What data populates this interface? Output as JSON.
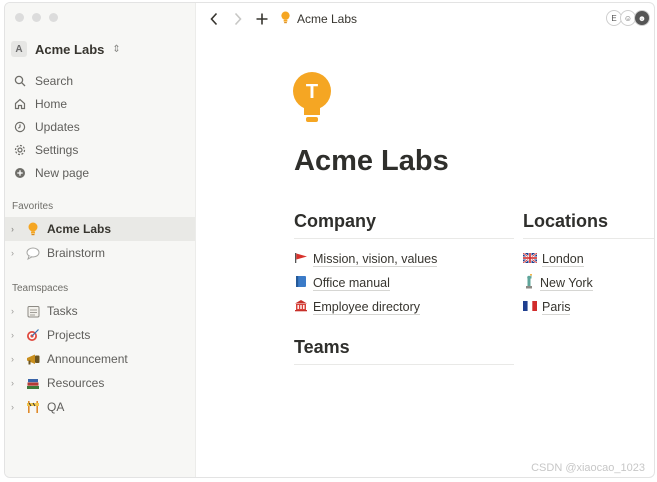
{
  "workspace": {
    "name": "Acme Labs",
    "avatar_letter": "A",
    "chevron": "⇕"
  },
  "sidebar": {
    "nav": [
      {
        "label": "Search",
        "icon": "search-icon"
      },
      {
        "label": "Home",
        "icon": "home-icon"
      },
      {
        "label": "Updates",
        "icon": "clock-icon"
      },
      {
        "label": "Settings",
        "icon": "gear-icon"
      },
      {
        "label": "New page",
        "icon": "plus-circle-icon"
      }
    ],
    "favorites_label": "Favorites",
    "favorites": [
      {
        "label": "Acme Labs",
        "emoji": "lightbulb-icon",
        "active": true
      },
      {
        "label": "Brainstorm",
        "emoji": "speech-bubble-icon",
        "active": false
      }
    ],
    "teamspaces_label": "Teamspaces",
    "teamspaces": [
      {
        "label": "Tasks",
        "emoji": "calendar-icon"
      },
      {
        "label": "Projects",
        "emoji": "target-icon"
      },
      {
        "label": "Announcement",
        "emoji": "megaphone-icon"
      },
      {
        "label": "Resources",
        "emoji": "books-icon"
      },
      {
        "label": "QA",
        "emoji": "construction-icon"
      }
    ]
  },
  "topbar": {
    "breadcrumb": "Acme Labs",
    "back": "‹",
    "forward": "›",
    "new": "+",
    "avatars": [
      "E",
      "☺",
      "☻"
    ]
  },
  "page": {
    "title": "Acme Labs",
    "icon_letter": "T",
    "company_heading": "Company",
    "company_links": [
      {
        "label": "Mission, vision, values",
        "emoji": "red-flag-icon"
      },
      {
        "label": "Office manual",
        "emoji": "blue-book-icon"
      },
      {
        "label": "Employee directory",
        "emoji": "bank-icon"
      }
    ],
    "locations_heading": "Locations",
    "locations": [
      {
        "label": "London",
        "emoji": "uk-flag-icon"
      },
      {
        "label": "New York",
        "emoji": "statue-of-liberty-icon"
      },
      {
        "label": "Paris",
        "emoji": "france-flag-icon"
      }
    ],
    "teams_heading": "Teams"
  },
  "watermark": "CSDN @xiaocao_1023",
  "colors": {
    "accent_yellow": "#f5a623",
    "sidebar_bg": "#f7f7f5",
    "active_bg": "#e9e9e6"
  }
}
